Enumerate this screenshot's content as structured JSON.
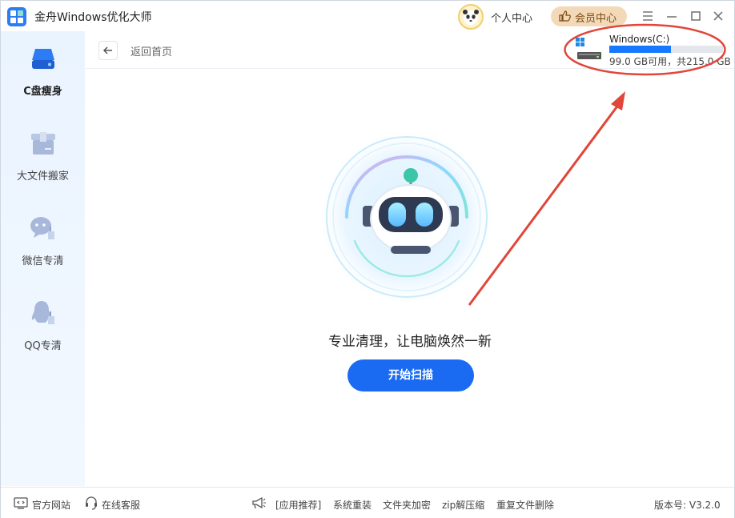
{
  "app": {
    "title": "金舟Windows优化大师",
    "profile_label": "个人中心",
    "vip_label": "会员中心"
  },
  "sidebar": {
    "items": [
      {
        "label": "C盘瘦身",
        "icon": "disk-icon",
        "active": true
      },
      {
        "label": "大文件搬家",
        "icon": "box-icon",
        "active": false
      },
      {
        "label": "微信专清",
        "icon": "wechat-clean-icon",
        "active": false
      },
      {
        "label": "QQ专清",
        "icon": "qq-clean-icon",
        "active": false
      }
    ]
  },
  "subheader": {
    "back_label": "返回首页"
  },
  "drive": {
    "name": "Windows(C:)",
    "space_text": "99.0 GB可用，共215.0 GB",
    "used_fraction": 0.54
  },
  "main": {
    "tagline": "专业清理，让电脑焕然一新",
    "scan_button": "开始扫描"
  },
  "footer": {
    "website": "官方网站",
    "support": "在线客服",
    "recommend": "[应用推荐]",
    "links": [
      "系统重装",
      "文件夹加密",
      "zip解压缩",
      "重复文件删除"
    ],
    "version": "版本号: V3.2.0"
  },
  "colors": {
    "accent": "#1a6bf2",
    "annotation": "#e0463a",
    "vip_bg": "#f4d9b8"
  }
}
